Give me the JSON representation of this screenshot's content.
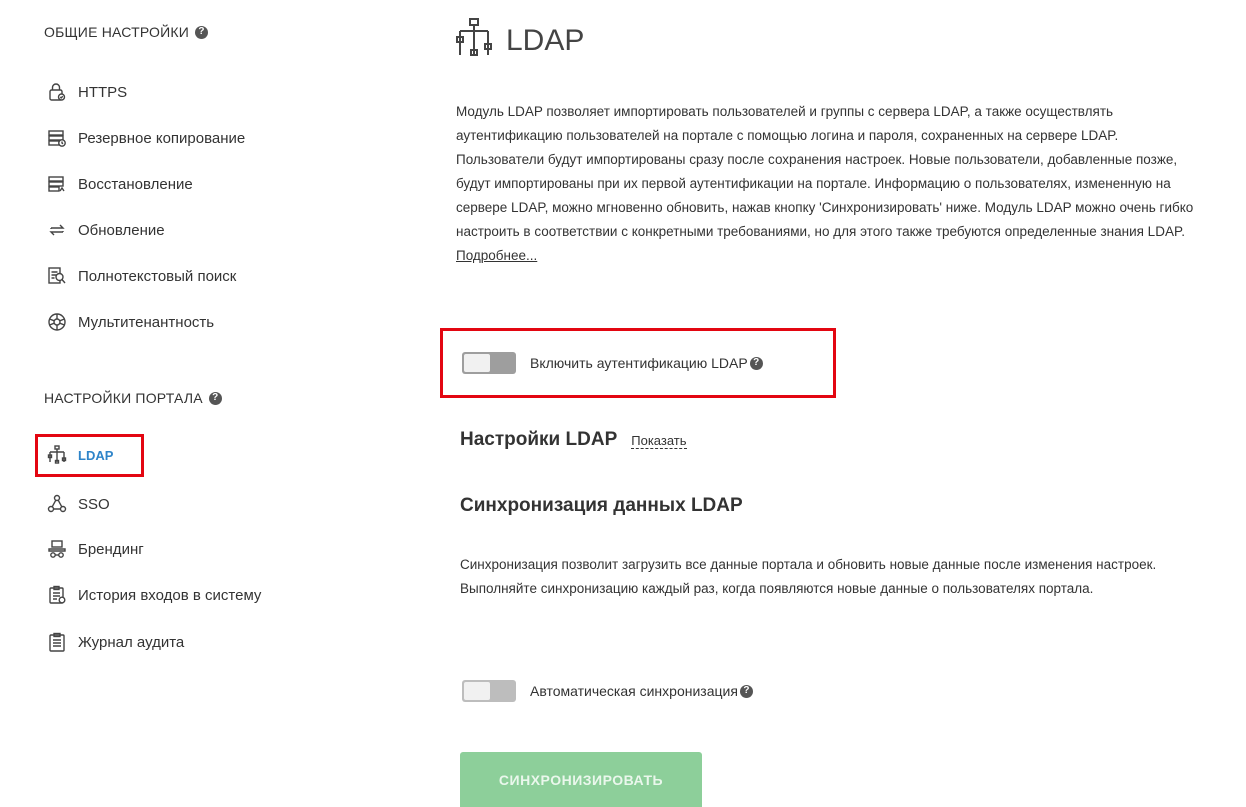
{
  "sidebar": {
    "general_title": "ОБЩИЕ НАСТРОЙКИ",
    "general_items": [
      {
        "label": "HTTPS",
        "icon": "lock-icon"
      },
      {
        "label": "Резервное копирование",
        "icon": "backup-icon"
      },
      {
        "label": "Восстановление",
        "icon": "restore-icon"
      },
      {
        "label": "Обновление",
        "icon": "update-icon"
      },
      {
        "label": "Полнотекстовый поиск",
        "icon": "fulltext-search-icon"
      },
      {
        "label": "Мультитенантность",
        "icon": "multitenancy-icon"
      }
    ],
    "portal_title": "НАСТРОЙКИ ПОРТАЛА",
    "portal_items": [
      {
        "label": "LDAP",
        "icon": "ldap-icon",
        "active": true
      },
      {
        "label": "SSO",
        "icon": "sso-icon"
      },
      {
        "label": "Брендинг",
        "icon": "branding-icon"
      },
      {
        "label": "История входов в систему",
        "icon": "login-history-icon"
      },
      {
        "label": "Журнал аудита",
        "icon": "audit-log-icon"
      }
    ]
  },
  "main": {
    "title": "LDAP",
    "description": "Модуль LDAP позволяет импортировать пользователей и группы с сервера LDAP, а также осуществлять аутентификацию пользователей на портале с помощью логина и пароля, сохраненных на сервере LDAP. Пользователи будут импортированы сразу после сохранения настроек. Новые пользователи, добавленные позже, будут импортированы при их первой аутентификации на портале. Информацию о пользователях, измененную на сервере LDAP, можно мгновенно обновить, нажав кнопку 'Синхронизировать' ниже. Модуль LDAP можно очень гибко настроить в соответствии с конкретными требованиями, но для этого также требуются определенные знания LDAP.",
    "more_link": "Подробнее...",
    "enable_toggle_label": "Включить аутентификацию LDAP",
    "settings_heading": "Настройки LDAP",
    "show_link": "Показать",
    "sync_heading": "Синхронизация данных LDAP",
    "sync_description": "Синхронизация позволит загрузить все данные портала и обновить новые данные после изменения настроек. Выполняйте синхронизацию каждый раз, когда появляются новые данные о пользователях портала.",
    "auto_sync_label": "Автоматическая синхронизация",
    "sync_button": "СИНХРОНИЗИРОВАТЬ"
  },
  "colors": {
    "highlight": "#e30611",
    "active_link": "#2e84c9",
    "button_disabled": "#8dcf9a"
  }
}
